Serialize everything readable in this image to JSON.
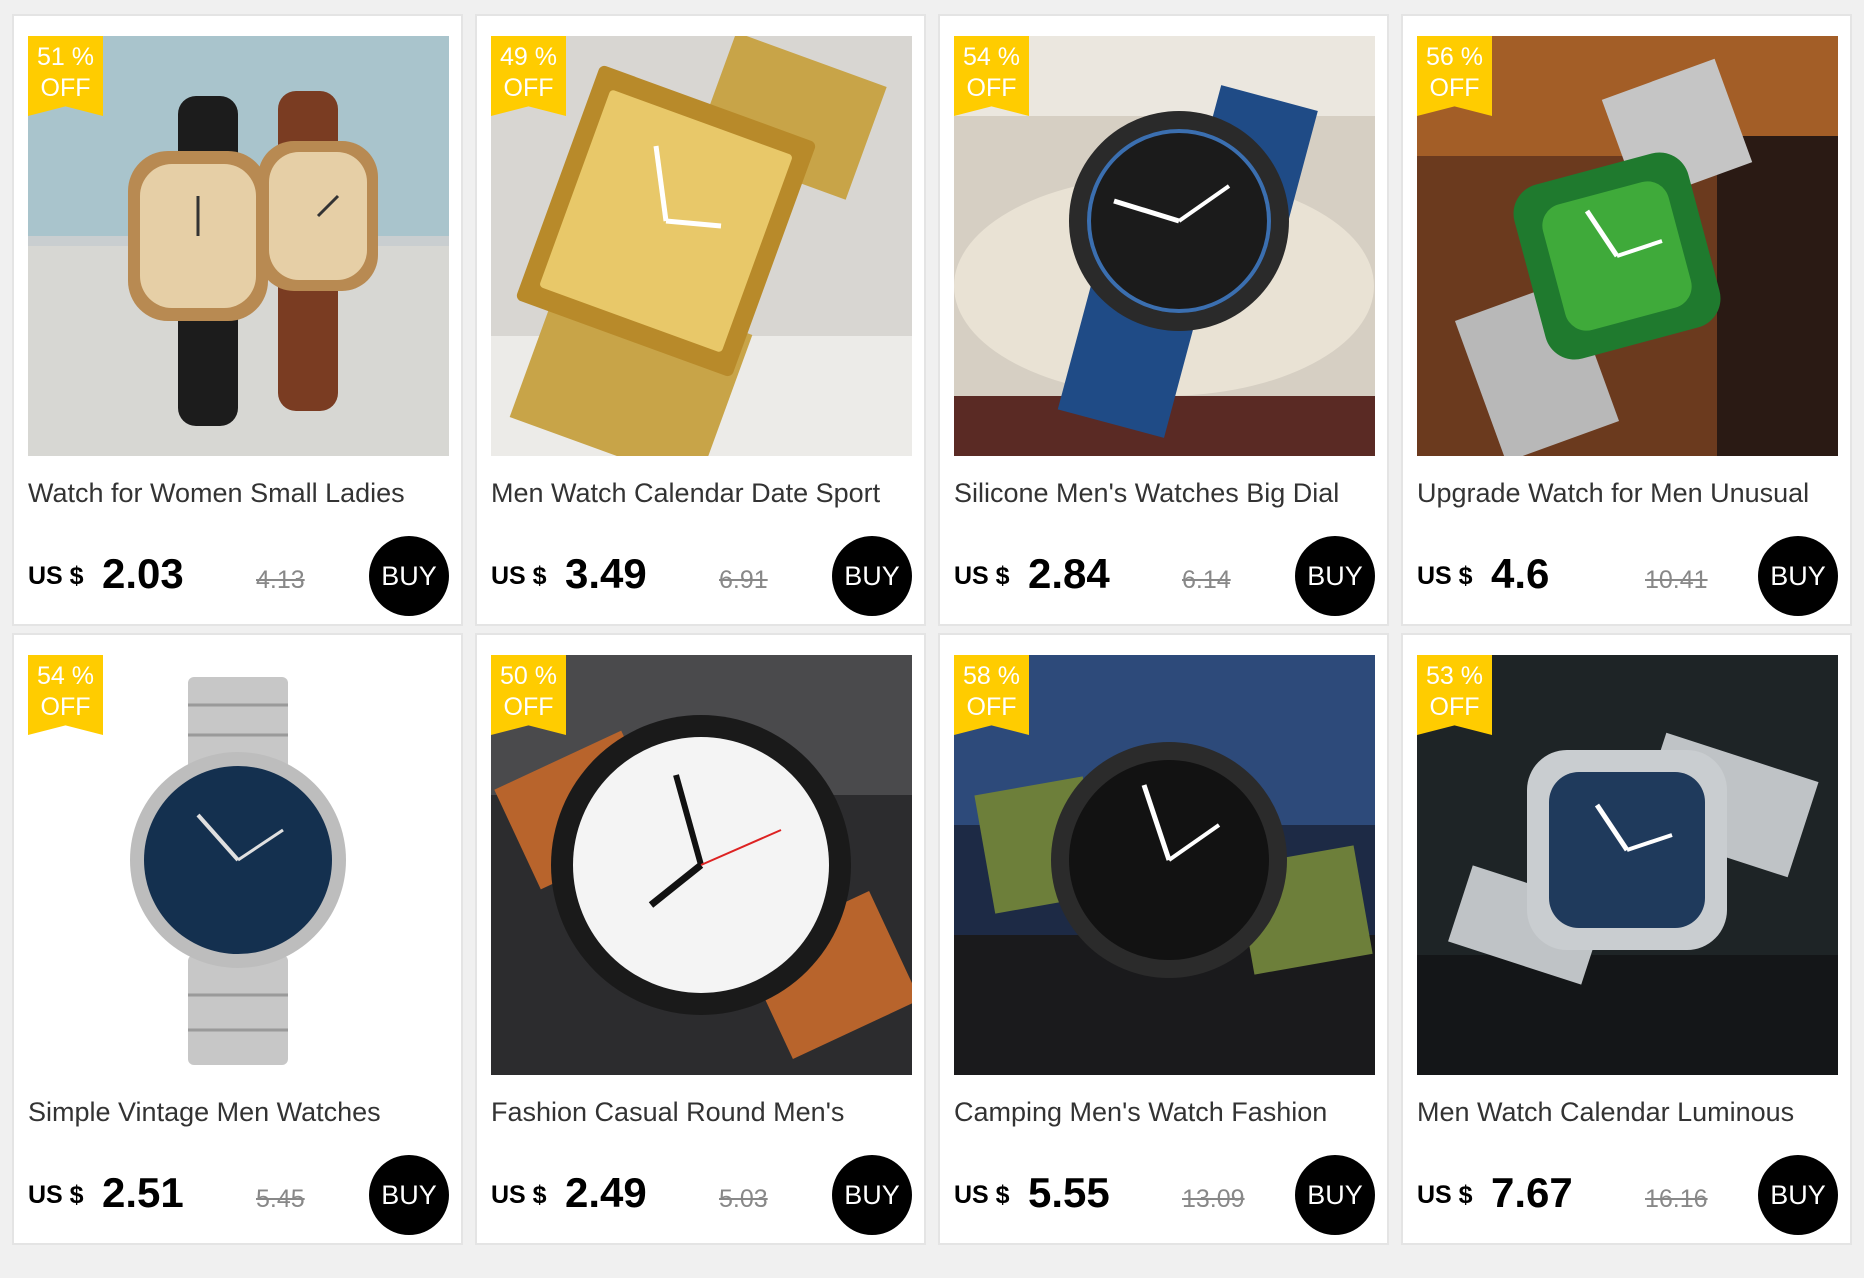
{
  "badge_off_label": "OFF",
  "currency_label": "US $",
  "buy_label": "BUY",
  "colors": {
    "badge": "#ffcc00",
    "buy_button": "#000000",
    "old_price": "#888888"
  },
  "products": [
    {
      "discount": "51 %",
      "title": "Watch for Women Small Ladies",
      "price": "2.03",
      "old_price": "4.13",
      "image": "couple-leather-watches"
    },
    {
      "discount": "49 %",
      "title": "Men Watch Calendar Date Sport",
      "price": "3.49",
      "old_price": "6.91",
      "image": "gold-rectangular-mesh-watch"
    },
    {
      "discount": "54 %",
      "title": "Silicone Men's Watches Big Dial",
      "price": "2.84",
      "old_price": "6.14",
      "image": "blue-silicone-sport-watch"
    },
    {
      "discount": "56 %",
      "title": "Upgrade Watch for Men Unusual",
      "price": "4.6",
      "old_price": "10.41",
      "image": "green-dial-steel-watch"
    },
    {
      "discount": "54 %",
      "title": "Simple Vintage Men Watches",
      "price": "2.51",
      "old_price": "5.45",
      "image": "silver-blue-dial-watch"
    },
    {
      "discount": "50 %",
      "title": "Fashion Casual Round Men's",
      "price": "2.49",
      "old_price": "5.03",
      "image": "white-dial-brown-strap-watch"
    },
    {
      "discount": "58 %",
      "title": "Camping Men's Watch Fashion",
      "price": "5.55",
      "old_price": "13.09",
      "image": "green-nylon-strap-watch"
    },
    {
      "discount": "53 %",
      "title": "Men Watch Calendar Luminous",
      "price": "7.67",
      "old_price": "16.16",
      "image": "octagon-steel-watch"
    }
  ]
}
